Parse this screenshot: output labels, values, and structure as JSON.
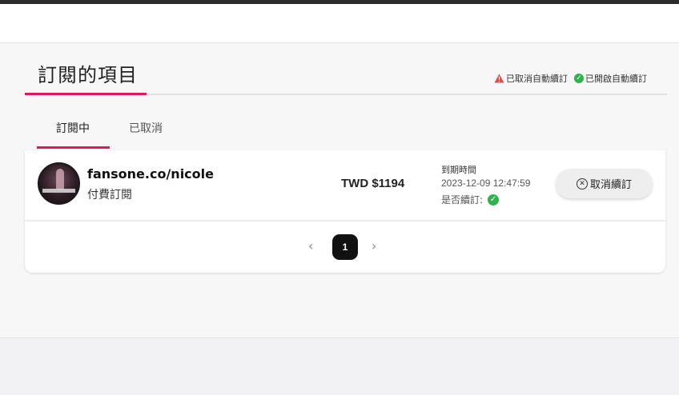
{
  "page": {
    "title": "訂閱的項目"
  },
  "legend": {
    "cancelled_label": "已取消自動續訂",
    "enabled_label": "已開啟自動續訂",
    "cancelled_icon": "warning-triangle-icon",
    "enabled_icon": "check-circle-icon"
  },
  "tabs": [
    {
      "label": "訂閱中",
      "active": true
    },
    {
      "label": "已取消",
      "active": false
    }
  ],
  "subscriptions": [
    {
      "creator": "fansone.co/nicole",
      "type": "付費訂閱",
      "price": "TWD $1194",
      "expiry_label": "到期時間",
      "expiry_date": "2023-12-09 12:47:59",
      "renew_label": "是否續訂:",
      "renew_enabled": true,
      "cancel_label": "取消續訂"
    }
  ],
  "pagination": {
    "current_page": "1",
    "prev_glyph": "‹",
    "next_glyph": "›"
  },
  "colors": {
    "accent": "#d81b5a",
    "success": "#2fb34a",
    "warning": "#e5484d"
  }
}
